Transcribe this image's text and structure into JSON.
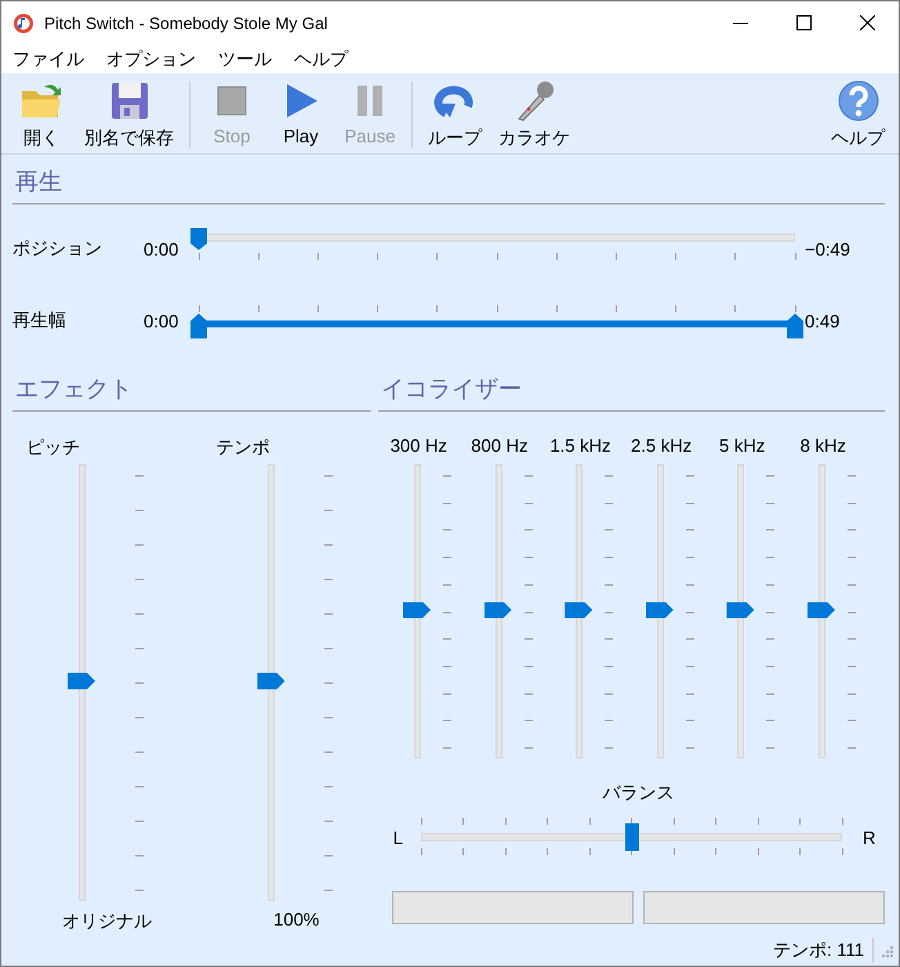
{
  "window": {
    "title": "Pitch Switch - Somebody Stole My Gal"
  },
  "menu": [
    "ファイル",
    "オプション",
    "ツール",
    "ヘルプ"
  ],
  "toolbar": {
    "groups": [
      [
        {
          "label": "開く",
          "kind": "open",
          "disabled": false
        },
        {
          "label": "別名で保存",
          "kind": "save",
          "disabled": false
        }
      ],
      [
        {
          "label": "Stop",
          "kind": "stop",
          "disabled": true
        },
        {
          "label": "Play",
          "kind": "play",
          "disabled": false
        },
        {
          "label": "Pause",
          "kind": "pause",
          "disabled": true
        }
      ],
      [
        {
          "label": "ループ",
          "kind": "loop",
          "disabled": false
        },
        {
          "label": "カラオケ",
          "kind": "mic",
          "disabled": false
        }
      ]
    ],
    "end": [
      {
        "label": "ヘルプ",
        "kind": "help",
        "disabled": false
      }
    ]
  },
  "playback": {
    "title": "再生",
    "position": {
      "label": "ポジション",
      "start": "0:00",
      "end": "−0:49",
      "level": 0
    },
    "range": {
      "label": "再生幅",
      "start": "0:00",
      "end": "0:49",
      "level": 1
    }
  },
  "effects": {
    "title": "エフェクト",
    "sliders": [
      {
        "label": "ピッチ",
        "reading": "オリジナル",
        "level": 0.5
      },
      {
        "label": "テンポ",
        "reading": "100%",
        "level": 0.5
      }
    ]
  },
  "equalizer": {
    "title": "イコライザー",
    "bands": [
      {
        "label": "300 Hz",
        "level": 0.5
      },
      {
        "label": "800 Hz",
        "level": 0.5
      },
      {
        "label": "1.5 kHz",
        "level": 0.5
      },
      {
        "label": "2.5 kHz",
        "level": 0.5
      },
      {
        "label": "5 kHz",
        "level": 0.5
      },
      {
        "label": "8 kHz",
        "level": 0.5
      }
    ],
    "balance": {
      "label": "バランス",
      "left": "L",
      "right": "R",
      "level": 0.5
    }
  },
  "status_bar": {
    "text": "テンポ: 111"
  }
}
